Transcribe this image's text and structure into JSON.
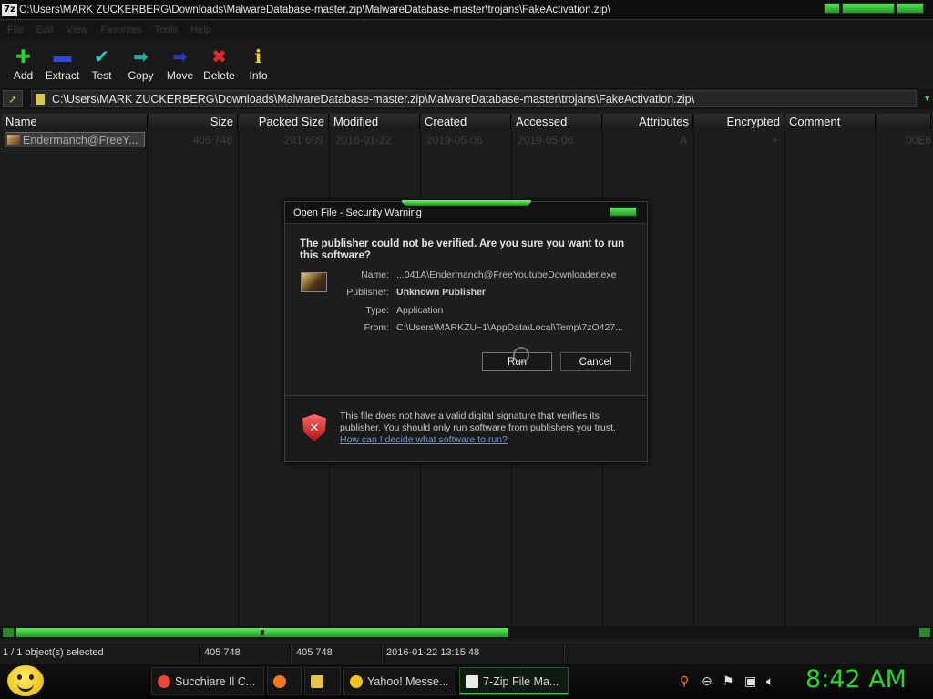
{
  "window": {
    "title": "C:\\Users\\MARK ZUCKERBERG\\Downloads\\MalwareDatabase-master.zip\\MalwareDatabase-master\\trojans\\FakeActivation.zip\\",
    "logo": "7z"
  },
  "menu": [
    "File",
    "Edit",
    "View",
    "Favorites",
    "Tools",
    "Help"
  ],
  "toolbar": [
    {
      "label": "Add",
      "icon": "plus-icon",
      "glyph": "✚",
      "color": "#2fd12f"
    },
    {
      "label": "Extract",
      "icon": "minus-icon",
      "glyph": "▬",
      "color": "#2b4bd6"
    },
    {
      "label": "Test",
      "icon": "check-icon",
      "glyph": "✔",
      "color": "#2ac8c8"
    },
    {
      "label": "Copy",
      "icon": "copy-arrow-icon",
      "glyph": "➡",
      "color": "#2aa8a0"
    },
    {
      "label": "Move",
      "icon": "move-arrow-icon",
      "glyph": "➡",
      "color": "#2a3ab0"
    },
    {
      "label": "Delete",
      "icon": "delete-x-icon",
      "glyph": "✖",
      "color": "#e02a2a"
    },
    {
      "label": "Info",
      "icon": "info-icon",
      "glyph": "ℹ",
      "color": "#e6d23a"
    }
  ],
  "address": {
    "path": "C:\\Users\\MARK ZUCKERBERG\\Downloads\\MalwareDatabase-master.zip\\MalwareDatabase-master\\trojans\\FakeActivation.zip\\"
  },
  "columns": [
    "Name",
    "Size",
    "Packed Size",
    "Modified",
    "Created",
    "Accessed",
    "Attributes",
    "Encrypted",
    "Comment",
    ""
  ],
  "rows": [
    {
      "name": "Endermanch@FreeY...",
      "size": "405 748",
      "packed": "281 609",
      "modified": "2016-01-22",
      "created": "2019-05-06",
      "accessed": "2019-05-06",
      "attributes": "A",
      "encrypted": "+",
      "comment": "",
      "crc": "00E6"
    }
  ],
  "status": {
    "selected": "1 / 1 object(s) selected",
    "size": "405 748",
    "packed": "405 748",
    "modified": "2016-01-22 13:15:48"
  },
  "dialog": {
    "title": "Open File - Security Warning",
    "question": "The publisher could not be verified.  Are you sure you want to run this software?",
    "name_label": "Name:",
    "name_value": "...041A\\Endermanch@FreeYoutubeDownloader.exe",
    "publisher_label": "Publisher:",
    "publisher_value": "Unknown Publisher",
    "type_label": "Type:",
    "type_value": "Application",
    "from_label": "From:",
    "from_value": "C:\\Users\\MARKZU~1\\AppData\\Local\\Temp\\7zO427...",
    "run_label": "Run",
    "cancel_label": "Cancel",
    "footer_text": "This file does not have a valid digital signature that verifies its publisher.  You should only run software from publishers you trust.",
    "footer_link": "How can I decide what software to run?"
  },
  "taskbar": {
    "tasks": [
      {
        "label": "Succhiare Il C...",
        "icon": "chrome-icon",
        "color": "#e24a3a"
      },
      {
        "label": "",
        "icon": "firefox-icon",
        "color": "#f07a1a"
      },
      {
        "label": "",
        "icon": "folder-icon",
        "color": "#e6c24a"
      },
      {
        "label": "Yahoo! Messe...",
        "icon": "yahoo-smiley-icon",
        "color": "#f2c21a"
      },
      {
        "label": "7-Zip File Ma...",
        "icon": "7zip-icon",
        "color": "#eaeaea"
      }
    ],
    "clock": "8:42 AM"
  }
}
